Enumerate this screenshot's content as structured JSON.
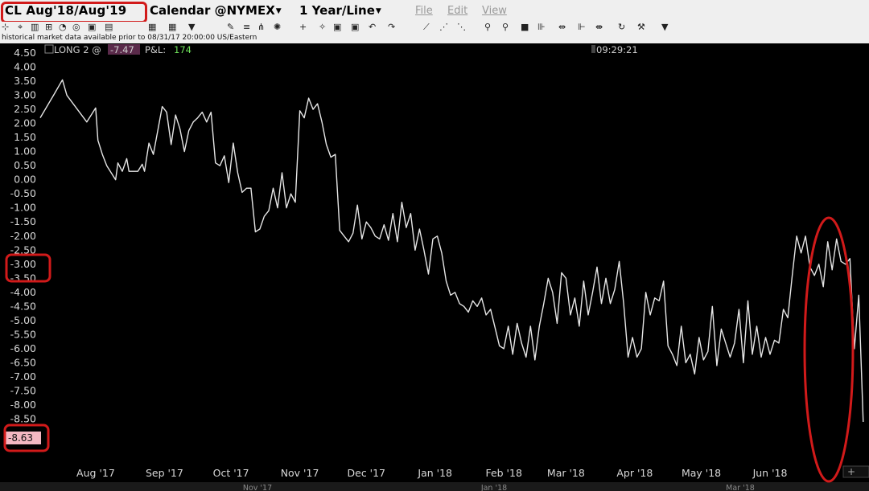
{
  "window": {
    "symbol": "CL Aug'18/Aug'19",
    "contract_type": "Calendar @NYMEX",
    "period": "1 Year/Line",
    "menus": [
      "File",
      "Edit",
      "View"
    ]
  },
  "notice": "historical market data available prior to 08/31/17 20:00:00 US/Eastern",
  "legend": {
    "label": "LONG 2 @",
    "price": "-7.47",
    "pnl_label": "P&L:",
    "pnl_value": "174",
    "time": "09:29:21"
  },
  "last_value_label": "-8.63",
  "colors": {
    "accent": "#d11a1a",
    "line": "#e6e6e6",
    "pnl": "#6ee05a",
    "price_bg": "#f3b8c2"
  },
  "toolbar_icons": [
    "cursor-icon",
    "crosshair-icon",
    "chart-bar-icon",
    "pie-icon",
    "layout-icon",
    "grid-icon",
    "dropdown-icon",
    "pencil-icon",
    "magnet-icon",
    "globe-icon",
    "plus-icon",
    "magic-icon",
    "save-icon",
    "print-icon",
    "undo-icon",
    "redo-icon",
    "draw-line-icon",
    "fib-icon",
    "zoom-in-icon",
    "zoom-out-icon",
    "square-icon",
    "bars-icon",
    "arrows-icon",
    "expand-icon",
    "refresh-icon",
    "tools-icon",
    "more-icon"
  ],
  "chart_data": {
    "type": "line",
    "title": "",
    "ylim": [
      -9.2,
      4.7
    ],
    "yticks": [
      "4.50",
      "4.00",
      "3.50",
      "3.00",
      "2.50",
      "2.00",
      "1.50",
      "1.00",
      "0.50",
      "0.00",
      "-0.50",
      "-1.00",
      "-1.50",
      "-2.00",
      "-2.50",
      "-3.00",
      "-3.50",
      "-4.00",
      "-4.50",
      "-5.00",
      "-5.50",
      "-6.00",
      "-6.50",
      "-7.00",
      "-7.50",
      "-8.00",
      "-8.50"
    ],
    "ytick_values": [
      4.5,
      4.0,
      3.5,
      3.0,
      2.5,
      2.0,
      1.5,
      1.0,
      0.5,
      0.0,
      -0.5,
      -1.0,
      -1.5,
      -2.0,
      -2.5,
      -3.0,
      -3.5,
      -4.0,
      -4.5,
      -5.0,
      -5.5,
      -6.0,
      -6.5,
      -7.0,
      -7.5,
      -8.0,
      -8.5
    ],
    "xlim": [
      "2017-07-07",
      "2018-07-04"
    ],
    "xticks": [
      {
        "label": "Aug '17",
        "date": "2017-08-01"
      },
      {
        "label": "Sep '17",
        "date": "2017-09-01"
      },
      {
        "label": "Oct '17",
        "date": "2017-10-01"
      },
      {
        "label": "Nov '17",
        "date": "2017-11-01"
      },
      {
        "label": "Dec '17",
        "date": "2017-12-01"
      },
      {
        "label": "Jan '18",
        "date": "2018-01-01"
      },
      {
        "label": "Feb '18",
        "date": "2018-02-01"
      },
      {
        "label": "Mar '18",
        "date": "2018-03-01"
      },
      {
        "label": "Apr '18",
        "date": "2018-04-01"
      },
      {
        "label": "May '18",
        "date": "2018-05-01"
      },
      {
        "label": "Jun '18",
        "date": "2018-06-01"
      }
    ],
    "sub_labels": [
      "Nov '17",
      "Jan '18",
      "Mar '18"
    ],
    "series": [
      {
        "values": [
          [
            "2017-07-07",
            2.2
          ],
          [
            "2017-07-13",
            3.0
          ],
          [
            "2017-07-17",
            3.55
          ],
          [
            "2017-07-19",
            3.0
          ],
          [
            "2017-07-28",
            2.05
          ],
          [
            "2017-08-01",
            2.55
          ],
          [
            "2017-08-02",
            1.4
          ],
          [
            "2017-08-04",
            0.9
          ],
          [
            "2017-08-06",
            0.5
          ],
          [
            "2017-08-10",
            0.0
          ],
          [
            "2017-08-11",
            0.6
          ],
          [
            "2017-08-13",
            0.3
          ],
          [
            "2017-08-15",
            0.75
          ],
          [
            "2017-08-16",
            0.3
          ],
          [
            "2017-08-20",
            0.3
          ],
          [
            "2017-08-22",
            0.55
          ],
          [
            "2017-08-23",
            0.3
          ],
          [
            "2017-08-25",
            1.3
          ],
          [
            "2017-08-27",
            0.9
          ],
          [
            "2017-08-31",
            2.6
          ],
          [
            "2017-09-02",
            2.4
          ],
          [
            "2017-09-04",
            1.25
          ],
          [
            "2017-09-06",
            2.3
          ],
          [
            "2017-09-08",
            1.8
          ],
          [
            "2017-09-10",
            1.0
          ],
          [
            "2017-09-12",
            1.75
          ],
          [
            "2017-09-14",
            2.05
          ],
          [
            "2017-09-16",
            2.2
          ],
          [
            "2017-09-18",
            2.4
          ],
          [
            "2017-09-20",
            2.05
          ],
          [
            "2017-09-22",
            2.4
          ],
          [
            "2017-09-24",
            0.6
          ],
          [
            "2017-09-26",
            0.5
          ],
          [
            "2017-09-28",
            0.85
          ],
          [
            "2017-09-30",
            -0.1
          ],
          [
            "2017-10-02",
            1.3
          ],
          [
            "2017-10-04",
            0.25
          ],
          [
            "2017-10-06",
            -0.45
          ],
          [
            "2017-10-08",
            -0.3
          ],
          [
            "2017-10-10",
            -0.3
          ],
          [
            "2017-10-12",
            -1.85
          ],
          [
            "2017-10-14",
            -1.75
          ],
          [
            "2017-10-16",
            -1.3
          ],
          [
            "2017-10-18",
            -1.1
          ],
          [
            "2017-10-20",
            -0.3
          ],
          [
            "2017-10-22",
            -1.0
          ],
          [
            "2017-10-24",
            0.25
          ],
          [
            "2017-10-26",
            -1.0
          ],
          [
            "2017-10-28",
            -0.5
          ],
          [
            "2017-10-30",
            -0.8
          ],
          [
            "2017-11-01",
            2.45
          ],
          [
            "2017-11-03",
            2.2
          ],
          [
            "2017-11-05",
            2.9
          ],
          [
            "2017-11-07",
            2.5
          ],
          [
            "2017-11-09",
            2.7
          ],
          [
            "2017-11-11",
            2.05
          ],
          [
            "2017-11-13",
            1.25
          ],
          [
            "2017-11-15",
            0.8
          ],
          [
            "2017-11-17",
            0.9
          ],
          [
            "2017-11-19",
            -1.8
          ],
          [
            "2017-11-21",
            -2.0
          ],
          [
            "2017-11-23",
            -2.2
          ],
          [
            "2017-11-25",
            -1.9
          ],
          [
            "2017-11-27",
            -0.9
          ],
          [
            "2017-11-29",
            -2.1
          ],
          [
            "2017-12-01",
            -1.5
          ],
          [
            "2017-12-03",
            -1.7
          ],
          [
            "2017-12-05",
            -2.0
          ],
          [
            "2017-12-07",
            -2.1
          ],
          [
            "2017-12-09",
            -1.6
          ],
          [
            "2017-12-11",
            -2.15
          ],
          [
            "2017-12-13",
            -1.2
          ],
          [
            "2017-12-15",
            -2.2
          ],
          [
            "2017-12-17",
            -0.8
          ],
          [
            "2017-12-19",
            -1.7
          ],
          [
            "2017-12-21",
            -1.2
          ],
          [
            "2017-12-23",
            -2.5
          ],
          [
            "2017-12-25",
            -1.75
          ],
          [
            "2017-12-27",
            -2.5
          ],
          [
            "2017-12-29",
            -3.35
          ],
          [
            "2017-12-31",
            -2.1
          ],
          [
            "2018-01-02",
            -2.0
          ],
          [
            "2018-01-04",
            -2.6
          ],
          [
            "2018-01-06",
            -3.6
          ],
          [
            "2018-01-08",
            -4.1
          ],
          [
            "2018-01-10",
            -4.0
          ],
          [
            "2018-01-12",
            -4.4
          ],
          [
            "2018-01-14",
            -4.5
          ],
          [
            "2018-01-16",
            -4.7
          ],
          [
            "2018-01-18",
            -4.3
          ],
          [
            "2018-01-20",
            -4.5
          ],
          [
            "2018-01-22",
            -4.2
          ],
          [
            "2018-01-24",
            -4.8
          ],
          [
            "2018-01-26",
            -4.6
          ],
          [
            "2018-01-28",
            -5.25
          ],
          [
            "2018-01-30",
            -5.9
          ],
          [
            "2018-02-01",
            -6.0
          ],
          [
            "2018-02-03",
            -5.2
          ],
          [
            "2018-02-05",
            -6.2
          ],
          [
            "2018-02-07",
            -5.1
          ],
          [
            "2018-02-09",
            -5.8
          ],
          [
            "2018-02-11",
            -6.3
          ],
          [
            "2018-02-13",
            -5.2
          ],
          [
            "2018-02-15",
            -6.4
          ],
          [
            "2018-02-17",
            -5.2
          ],
          [
            "2018-02-19",
            -4.4
          ],
          [
            "2018-02-21",
            -3.5
          ],
          [
            "2018-02-23",
            -4.0
          ],
          [
            "2018-02-25",
            -5.1
          ],
          [
            "2018-02-27",
            -3.3
          ],
          [
            "2018-03-01",
            -3.5
          ],
          [
            "2018-03-03",
            -4.8
          ],
          [
            "2018-03-05",
            -4.2
          ],
          [
            "2018-03-07",
            -5.2
          ],
          [
            "2018-03-09",
            -3.6
          ],
          [
            "2018-03-11",
            -4.8
          ],
          [
            "2018-03-13",
            -4.0
          ],
          [
            "2018-03-15",
            -3.1
          ],
          [
            "2018-03-17",
            -4.4
          ],
          [
            "2018-03-19",
            -3.5
          ],
          [
            "2018-03-21",
            -4.4
          ],
          [
            "2018-03-23",
            -3.9
          ],
          [
            "2018-03-25",
            -2.9
          ],
          [
            "2018-03-27",
            -4.4
          ],
          [
            "2018-03-29",
            -6.3
          ],
          [
            "2018-03-31",
            -5.6
          ],
          [
            "2018-04-02",
            -6.3
          ],
          [
            "2018-04-04",
            -6.0
          ],
          [
            "2018-04-06",
            -4.0
          ],
          [
            "2018-04-08",
            -4.8
          ],
          [
            "2018-04-10",
            -4.2
          ],
          [
            "2018-04-12",
            -4.3
          ],
          [
            "2018-04-14",
            -3.6
          ],
          [
            "2018-04-16",
            -5.9
          ],
          [
            "2018-04-18",
            -6.2
          ],
          [
            "2018-04-20",
            -6.6
          ],
          [
            "2018-04-22",
            -5.2
          ],
          [
            "2018-04-24",
            -6.5
          ],
          [
            "2018-04-26",
            -6.2
          ],
          [
            "2018-04-28",
            -6.9
          ],
          [
            "2018-04-30",
            -5.6
          ],
          [
            "2018-05-02",
            -6.4
          ],
          [
            "2018-05-04",
            -6.1
          ],
          [
            "2018-05-06",
            -4.5
          ],
          [
            "2018-05-08",
            -6.6
          ],
          [
            "2018-05-10",
            -5.3
          ],
          [
            "2018-05-12",
            -5.8
          ],
          [
            "2018-05-14",
            -6.3
          ],
          [
            "2018-05-16",
            -5.8
          ],
          [
            "2018-05-18",
            -4.6
          ],
          [
            "2018-05-20",
            -6.5
          ],
          [
            "2018-05-22",
            -4.3
          ],
          [
            "2018-05-24",
            -6.2
          ],
          [
            "2018-05-26",
            -5.2
          ],
          [
            "2018-05-28",
            -6.3
          ],
          [
            "2018-05-30",
            -5.6
          ],
          [
            "2018-06-01",
            -6.2
          ],
          [
            "2018-06-03",
            -5.7
          ],
          [
            "2018-06-05",
            -5.8
          ],
          [
            "2018-06-07",
            -4.6
          ],
          [
            "2018-06-09",
            -4.9
          ],
          [
            "2018-06-11",
            -3.4
          ],
          [
            "2018-06-13",
            -2.0
          ],
          [
            "2018-06-15",
            -2.6
          ],
          [
            "2018-06-17",
            -2.0
          ],
          [
            "2018-06-19",
            -3.1
          ],
          [
            "2018-06-21",
            -3.4
          ],
          [
            "2018-06-23",
            -3.0
          ],
          [
            "2018-06-25",
            -3.8
          ],
          [
            "2018-06-27",
            -2.2
          ],
          [
            "2018-06-29",
            -3.2
          ],
          [
            "2018-07-01",
            -2.1
          ],
          [
            "2018-07-03",
            -2.9
          ],
          [
            "2018-07-05",
            -3.0
          ],
          [
            "2018-07-07",
            -2.8
          ],
          [
            "2018-07-09",
            -6.0
          ],
          [
            "2018-07-11",
            -4.1
          ],
          [
            "2018-07-13",
            -8.6
          ]
        ]
      }
    ],
    "grid": false,
    "legend": "top-left"
  }
}
